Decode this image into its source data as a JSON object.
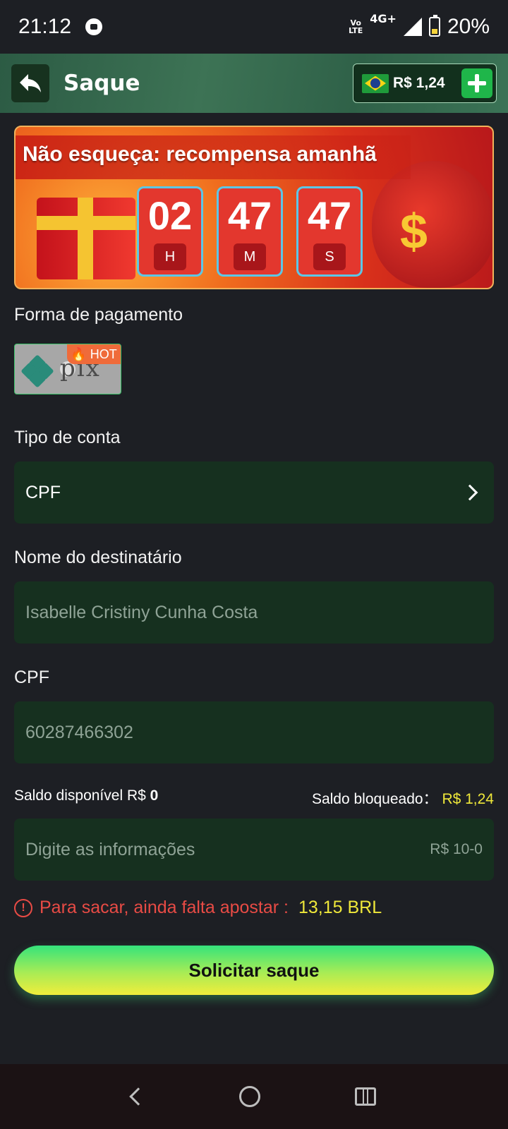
{
  "status_bar": {
    "time": "21:12",
    "volte": "Vo LTE",
    "network": "4G+",
    "battery": "20%"
  },
  "header": {
    "title": "Saque",
    "balance": "R$ 1,24"
  },
  "banner": {
    "title": "Não esqueça: recompensa amanhã",
    "hours": "02",
    "minutes": "47",
    "seconds": "47",
    "hours_unit": "H",
    "minutes_unit": "M",
    "seconds_unit": "S",
    "dollar": "$"
  },
  "payment": {
    "label": "Forma de pagamento",
    "method": "pix",
    "badge": "HOT"
  },
  "account_type": {
    "label": "Tipo de conta",
    "value": "CPF"
  },
  "recipient": {
    "label": "Nome do destinatário",
    "value": "Isabelle Cristiny Cunha Costa"
  },
  "cpf": {
    "label": "CPF",
    "value": "60287466302"
  },
  "saldo": {
    "available_label": "Saldo disponível R$",
    "available_value": "0",
    "blocked_label": "Saldo bloqueado：",
    "blocked_value": "R$ 1,24"
  },
  "amount": {
    "placeholder": "Digite as informações",
    "range": "R$ 10-0"
  },
  "warning": {
    "text": "Para sacar, ainda falta apostar :",
    "amount": "13,15 BRL"
  },
  "submit_label": "Solicitar saque",
  "colors": {
    "accent": "#16301f",
    "warning": "#e84b45",
    "highlight": "#efe83a"
  }
}
